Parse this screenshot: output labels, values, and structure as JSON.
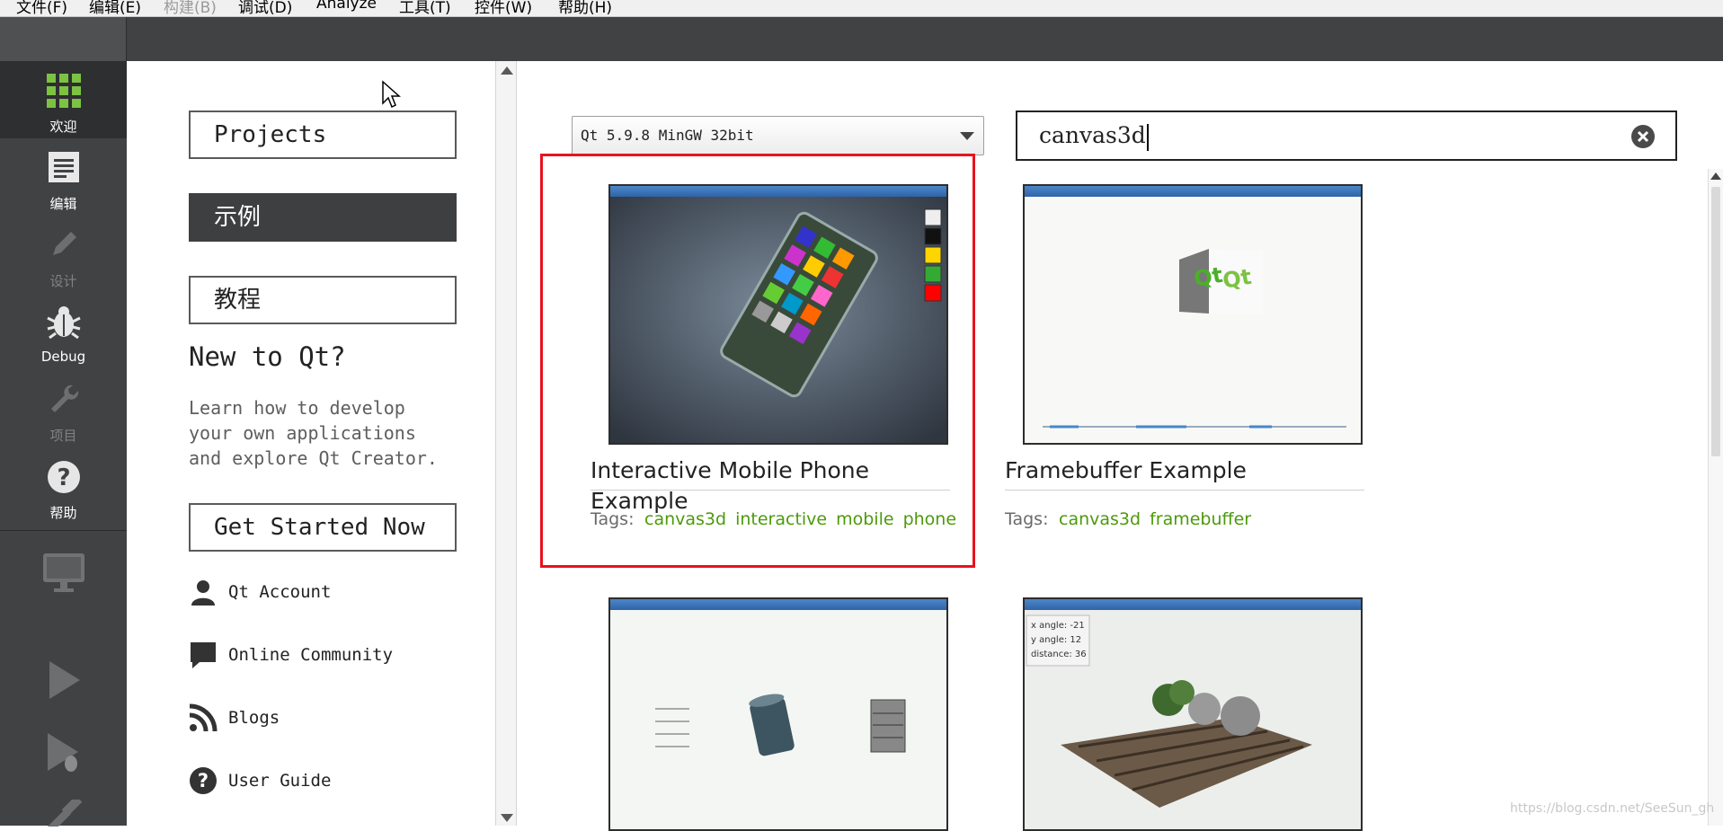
{
  "menu": {
    "items": [
      {
        "label": "文件(F)",
        "enabled": true
      },
      {
        "label": "编辑(E)",
        "enabled": true
      },
      {
        "label": "构建(B)",
        "enabled": false
      },
      {
        "label": "调试(D)",
        "enabled": true
      },
      {
        "label": "Analyze",
        "enabled": true
      },
      {
        "label": "工具(T)",
        "enabled": true
      },
      {
        "label": "控件(W)",
        "enabled": true
      },
      {
        "label": "帮助(H)",
        "enabled": true
      }
    ]
  },
  "sidebar": {
    "modes": [
      {
        "label": "欢迎",
        "icon": "welcome-grid-icon",
        "active": true
      },
      {
        "label": "编辑",
        "icon": "edit-document-icon",
        "active": false
      },
      {
        "label": "设计",
        "icon": "design-pencil-icon",
        "active": false
      },
      {
        "label": "Debug",
        "icon": "debug-bug-icon",
        "active": false
      },
      {
        "label": "项目",
        "icon": "projects-wrench-icon",
        "active": false
      },
      {
        "label": "帮助",
        "icon": "help-question-icon",
        "active": false
      }
    ],
    "bottom": [
      "kit-monitor-icon",
      "run-icon",
      "debug-run-icon",
      "build-hammer-icon"
    ]
  },
  "welcome": {
    "buttons": {
      "projects": "Projects",
      "examples": "示例",
      "tutorials": "教程",
      "get_started": "Get Started Now"
    },
    "new_to_qt": {
      "heading": "New to Qt?",
      "lines": [
        "Learn how to develop",
        "your own applications",
        "and explore Qt Creator."
      ]
    },
    "links": [
      {
        "label": "Qt Account",
        "icon": "user-icon"
      },
      {
        "label": "Online Community",
        "icon": "chat-bubble-icon"
      },
      {
        "label": "Blogs",
        "icon": "rss-icon"
      },
      {
        "label": "User Guide",
        "icon": "help-circle-icon"
      }
    ]
  },
  "examples": {
    "kit_selector": "Qt 5.9.8 MinGW 32bit",
    "search_value": "canvas3d",
    "tags_label": "Tags:",
    "cards": [
      {
        "title": "Interactive Mobile Phone Example",
        "tags": [
          "canvas3d",
          "interactive",
          "mobile",
          "phone"
        ],
        "highlighted": true
      },
      {
        "title": "Framebuffer Example",
        "tags": [
          "canvas3d",
          "framebuffer"
        ],
        "highlighted": false
      }
    ],
    "thumb_overlays": {
      "orbit_readout": [
        "x angle: -21",
        "y angle: 12",
        "distance: 36"
      ]
    }
  },
  "watermark": "https://blog.csdn.net/SeeSun_gh",
  "colors": {
    "sidebar_bg": "#404244",
    "active_mode_bg": "#2e2f30",
    "tag_green": "#4c9a0b",
    "highlight_red": "#e8121e",
    "welcome_green": "#7cc243"
  }
}
